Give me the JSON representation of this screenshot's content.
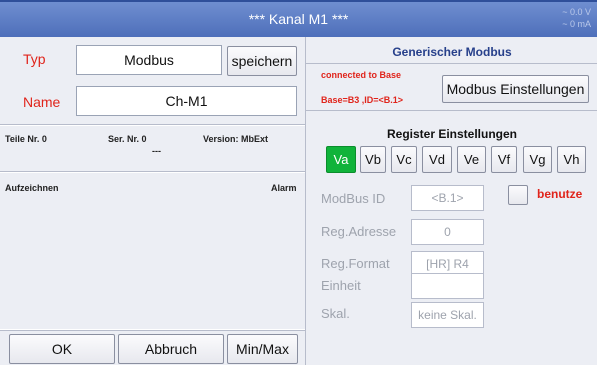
{
  "titlebar": {
    "title": "*** Kanal M1 ***",
    "voltage": "~ 0.0 V",
    "current": "~ 0 mA"
  },
  "left": {
    "type_label": "Typ",
    "type_value": "Modbus",
    "save_label": "speichern",
    "name_label": "Name",
    "name_value": "Ch-M1",
    "part_no": "Teile Nr. 0",
    "serial_no": "Ser. Nr.  0",
    "serial_sub": "---",
    "version": "Version: MbExt",
    "record_label": "Aufzeichnen",
    "alarm_label": "Alarm"
  },
  "bottom": {
    "ok_label": "OK",
    "cancel_label": "Abbruch",
    "minmax_label": "Min/Max"
  },
  "right": {
    "header": "Generischer Modbus",
    "connected": "connected to Base",
    "base_info": "Base=B3 ,ID=<B.1>",
    "modbus_settings_label": "Modbus Einstellungen",
    "register_header": "Register Einstellungen",
    "tabs": [
      "Va",
      "Vb",
      "Vc",
      "Vd",
      "Ve",
      "Vf",
      "Vg",
      "Vh"
    ],
    "active_tab": "Va",
    "modbus_id_label": "ModBus ID",
    "modbus_id_value": "<B.1>",
    "use_label": "benutze",
    "reg_address_label": "Reg.Adresse",
    "reg_address_value": "0",
    "reg_format_label": "Reg.Format",
    "reg_format_value": "[HR] R4",
    "unit_label": "Einheit",
    "unit_value": "",
    "scale_label": "Skal.",
    "scale_value": "keine Skal."
  },
  "colors": {
    "title_bar": "#5a7bc4",
    "accent_red": "#e0241b",
    "active_tab": "#10b33a",
    "panel_bg": "#eceef4"
  }
}
